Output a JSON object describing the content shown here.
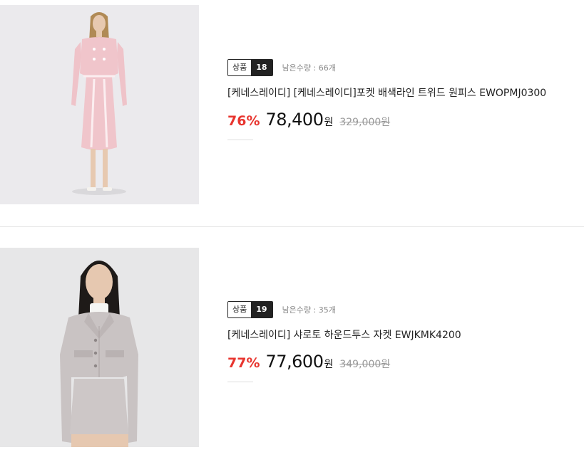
{
  "products": [
    {
      "badge_label": "상품",
      "badge_number": "18",
      "stock_text": "남은수량 : 66개",
      "title": "[케네스레이디] [케네스레이디]포켓 배색라인 트위드 원피스 EWOPMJ0300",
      "discount": "76%",
      "price": "78,400",
      "currency": "원",
      "original_price": "329,000원",
      "image_icon": "pink-tweed-dress-photo"
    },
    {
      "badge_label": "상품",
      "badge_number": "19",
      "stock_text": "남은수량 : 35개",
      "title": "[케네스레이디] 샤로토 하운드투스 자켓 EWJKMK4200",
      "discount": "77%",
      "price": "77,600",
      "currency": "원",
      "original_price": "349,000원",
      "image_icon": "gray-tweed-jacket-photo"
    }
  ],
  "colors": {
    "discount": "#e8352f",
    "badge_dark": "#222222"
  }
}
